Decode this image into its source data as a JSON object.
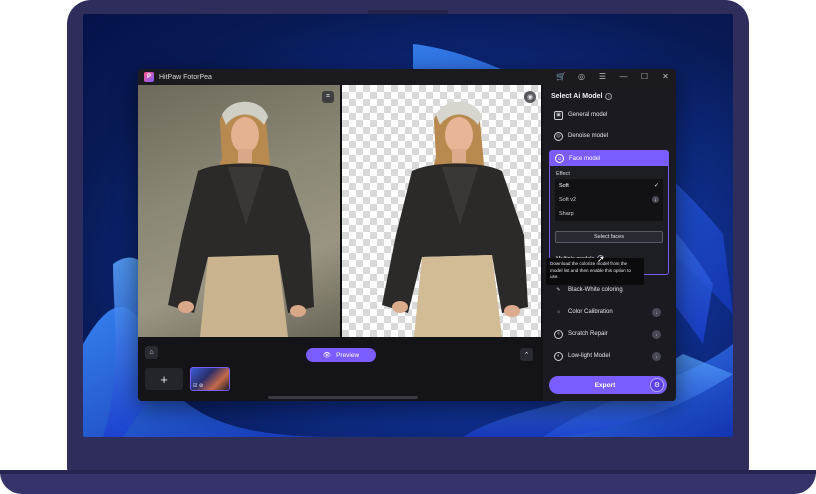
{
  "app": {
    "title": "HitPaw FotorPea",
    "logo_letter": "P",
    "accent_color": "#7a5cff"
  },
  "titlebar_icons": [
    "cart-icon",
    "user-icon",
    "menu-icon",
    "minimize-icon",
    "maximize-icon",
    "close-icon"
  ],
  "toolbar": {
    "preview_label": "Preview"
  },
  "panel": {
    "title": "Select Ai Model",
    "models_top": [
      {
        "label": "General model",
        "icon": "image-icon"
      },
      {
        "label": "Denoise model",
        "icon": "denoise-icon"
      }
    ],
    "face_model": {
      "label": "Face model",
      "effect_label": "Effect",
      "effects": [
        {
          "label": "Soft",
          "selected": true
        },
        {
          "label": "Soft v2",
          "selected": false
        },
        {
          "label": "Sharp",
          "selected": false
        }
      ],
      "select_faces_label": "Select faces",
      "multiple_models_label": "Multiple models"
    },
    "tooltip": "Download the colorize model from the model list and then enable this option to use.",
    "models_bottom": [
      {
        "label": "Black-White coloring"
      },
      {
        "label": "Color Calibration"
      },
      {
        "label": "Scratch Repair"
      },
      {
        "label": "Low-light Model"
      }
    ],
    "export_label": "Export"
  }
}
